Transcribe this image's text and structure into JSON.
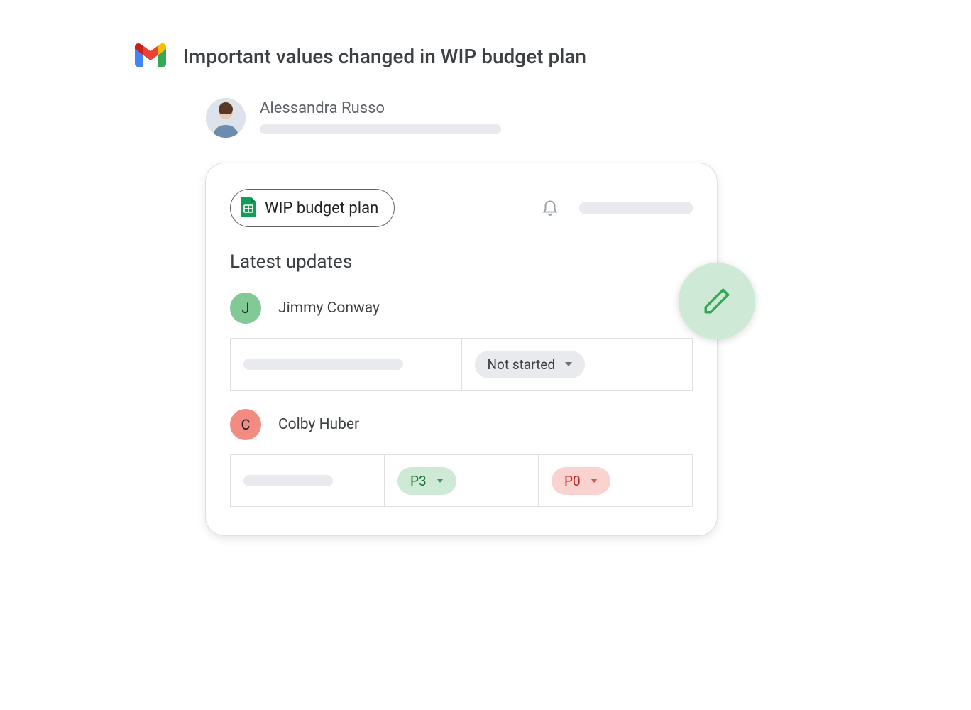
{
  "email": {
    "subject": "Important values changed in WIP budget plan",
    "sender_name": "Alessandra Russo"
  },
  "card": {
    "chip_label": "WIP budget plan",
    "section_title": "Latest updates",
    "updates": [
      {
        "initial": "J",
        "name": "Jimmy Conway",
        "avatar_color": "green",
        "cells": [
          {
            "type": "placeholder"
          },
          {
            "type": "pill",
            "label": "Not started",
            "color": "grey"
          }
        ]
      },
      {
        "initial": "C",
        "name": "Colby Huber",
        "avatar_color": "red",
        "cells": [
          {
            "type": "placeholder"
          },
          {
            "type": "pill",
            "label": "P3",
            "color": "green"
          },
          {
            "type": "pill",
            "label": "P0",
            "color": "red"
          }
        ]
      }
    ]
  }
}
